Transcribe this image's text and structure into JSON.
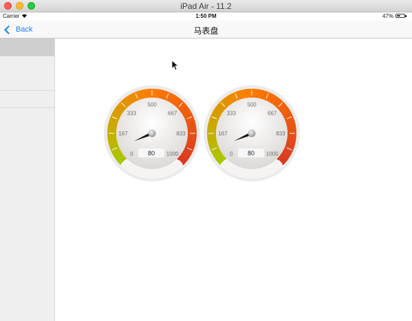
{
  "window": {
    "title": "iPad Air - 11.2"
  },
  "status_bar": {
    "carrier": "Carrier",
    "time": "1:50 PM",
    "battery_percent": "47%",
    "battery_level": 0.47
  },
  "nav": {
    "back_label": "Back",
    "title": "马表盘"
  },
  "sidebar": {
    "selected_index": 0,
    "rows": 3
  },
  "gauges": [
    {
      "value": "80",
      "ticks": [
        "0",
        "167",
        "333",
        "500",
        "667",
        "833",
        "1000"
      ]
    },
    {
      "value": "80",
      "ticks": [
        "0",
        "167",
        "333",
        "500",
        "667",
        "833",
        "1000"
      ]
    }
  ],
  "colors": {
    "accent": "#1a7cf5",
    "gauge_low": "#a8c800",
    "gauge_mid": "#ff7a00",
    "gauge_high": "#d93a22"
  }
}
